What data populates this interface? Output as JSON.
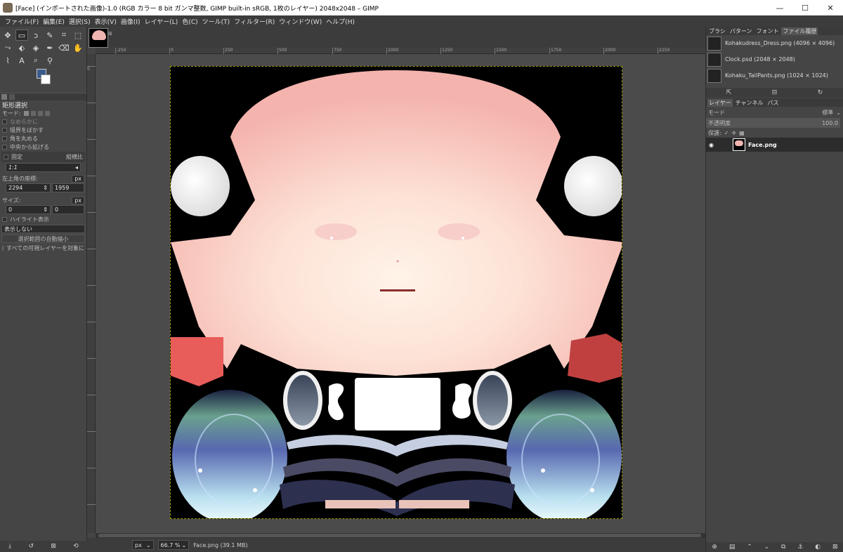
{
  "window": {
    "title": "[Face] (インポートされた画像)-1.0 (RGB カラー 8 bit ガンマ整数, GIMP built-in sRGB, 1枚のレイヤー) 2048x2048 – GIMP",
    "minimize": "—",
    "maximize": "☐",
    "close": "✕"
  },
  "menu": [
    "ファイル(F)",
    "編集(E)",
    "選択(S)",
    "表示(V)",
    "画像(I)",
    "レイヤー(L)",
    "色(C)",
    "ツール(T)",
    "フィルター(R)",
    "ウィンドウ(W)",
    "ヘルプ(H)"
  ],
  "toolbox": {
    "tools": [
      {
        "icon": "move-icon",
        "glyph": "✥"
      },
      {
        "icon": "rect-select-icon",
        "glyph": "▭"
      },
      {
        "icon": "lasso-icon",
        "glyph": "ↄ"
      },
      {
        "icon": "fuzzy-select-icon",
        "glyph": "✎"
      },
      {
        "icon": "crop-icon",
        "glyph": "⌗"
      },
      {
        "icon": "unified-transform-icon",
        "glyph": "⬚"
      },
      {
        "icon": "warp-icon",
        "glyph": "⤳"
      },
      {
        "icon": "handle-transform-icon",
        "glyph": "⬖"
      },
      {
        "icon": "paint-bucket-icon",
        "glyph": "◈"
      },
      {
        "icon": "paintbrush-icon",
        "glyph": "✒"
      },
      {
        "icon": "eraser-icon",
        "glyph": "⌫"
      },
      {
        "icon": "smudge-icon",
        "glyph": "✋"
      },
      {
        "icon": "paths-icon",
        "glyph": "⌇"
      },
      {
        "icon": "text-icon",
        "glyph": "A"
      },
      {
        "icon": "color-picker-icon",
        "glyph": "⌕"
      },
      {
        "icon": "zoom-icon",
        "glyph": "⚲"
      }
    ],
    "dock_title": "矩形選択",
    "mode_label": "モード:",
    "antialias": "なめらかに",
    "feather": "境界をぼかす",
    "rounded": "角を丸める",
    "expand_center": "中央から拡げる",
    "fixed": "固定",
    "fixed_mode": "縦横比",
    "ratio": "1:1",
    "position_label": "左上角の座標:",
    "unit1": "px",
    "pos_x": "2294",
    "pos_y": "1959",
    "size_label": "サイズ:",
    "unit2": "px",
    "size_w": "0",
    "size_h": "0",
    "highlight": "ハイライト表示",
    "guides": "表示しない",
    "auto_shrink": "選択範囲の自動縮小",
    "all_layers": "すべての可視レイヤーを対象に"
  },
  "rulers": {
    "top": [
      "-250",
      "0",
      "250",
      "500",
      "750",
      "1000",
      "1250",
      "1500",
      "1750",
      "2000",
      "2250"
    ],
    "left": [
      "0",
      "",
      "",
      "",
      "",
      "",
      "",
      "",
      "",
      "",
      "",
      "",
      ""
    ]
  },
  "status": {
    "unit": "px",
    "zoom": "66.7 %",
    "info": "Face.png (39.1 MB)"
  },
  "right_panel": {
    "tabs_top": [
      "ブラシ",
      "パターン",
      "フォント",
      "ファイル履歴"
    ],
    "history": [
      {
        "name": "Kohakudress_Dress.png (4096 × 4096)"
      },
      {
        "name": "Clock.psd (2048 × 2048)"
      },
      {
        "name": "Kohaku_TailPants.png (1024 × 1024)"
      }
    ],
    "tabs_layers": [
      "レイヤー",
      "チャンネル",
      "パス"
    ],
    "mode_label": "モード",
    "mode_value": "標準",
    "opacity_label": "不透明度",
    "opacity_value": "100.0",
    "lock_label": "保護:",
    "layer_name": "Face.png"
  }
}
